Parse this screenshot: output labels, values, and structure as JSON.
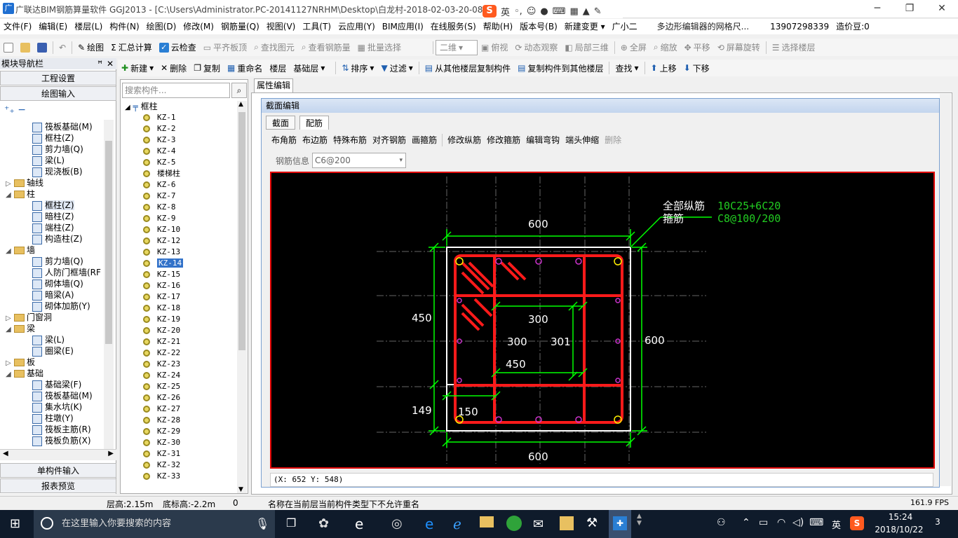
{
  "titlebar": {
    "title": "广联达BIM钢筋算量软件 GGJ2013 - [C:\\Users\\Administrator.PC-20141127NRHM\\Desktop\\白龙村-2018-02-03-20-08",
    "ime_label": "英",
    "minimize": "─",
    "restore": "❐",
    "close": "✕"
  },
  "menu": {
    "items": [
      "文件(F)",
      "编辑(E)",
      "楼层(L)",
      "构件(N)",
      "绘图(D)",
      "修改(M)",
      "钢筋量(Q)",
      "视图(V)",
      "工具(T)",
      "云应用(Y)",
      "BIM应用(I)",
      "在线服务(S)",
      "帮助(H)",
      "版本号(B)",
      "新建变更 ▾",
      "广小二",
      "多边形编辑器的网格尺..."
    ],
    "phone": "13907298339",
    "price_label": "造价豆:0"
  },
  "toolbar1": {
    "draw": "绘图",
    "sum": "汇总计算",
    "cloud_check": "云检查",
    "flat_top": "平齐板顶",
    "find_elem": "查找图元",
    "view_rebar": "查看钢筋量",
    "batch_select": "批量选择",
    "view_mode": "二维",
    "top_view": "俯视",
    "dynamic": "动态观察",
    "local3d": "局部三维",
    "fullscreen": "全屏",
    "zoom": "缩放",
    "pan": "平移",
    "rotate": "屏幕旋转",
    "select_floor": "选择楼层"
  },
  "toolbar2": {
    "new": "新建",
    "delete": "删除",
    "copy": "复制",
    "rename": "重命名",
    "floor": "楼层",
    "floor_value": "基础层",
    "sort": "排序",
    "filter": "过滤",
    "copy_from": "从其他楼层复制构件",
    "copy_to": "复制构件到其他楼层",
    "find": "查找",
    "move_up": "上移",
    "move_down": "下移"
  },
  "leftnav": {
    "header": "模块导航栏",
    "pin": "✕",
    "project_settings": "工程设置",
    "draw_input": "绘图输入",
    "single_input": "单构件输入",
    "report_preview": "报表预览",
    "tree": [
      {
        "label": "筏板基础(M)",
        "level": 2,
        "type": "item"
      },
      {
        "label": "框柱(Z)",
        "level": 2,
        "type": "item"
      },
      {
        "label": "剪力墙(Q)",
        "level": 2,
        "type": "item"
      },
      {
        "label": "梁(L)",
        "level": 2,
        "type": "item"
      },
      {
        "label": "现浇板(B)",
        "level": 2,
        "type": "item"
      },
      {
        "label": "轴线",
        "level": 1,
        "type": "folder",
        "exp": "▷"
      },
      {
        "label": "柱",
        "level": 1,
        "type": "folder",
        "exp": "◢"
      },
      {
        "label": "框柱(Z)",
        "level": 2,
        "type": "item",
        "selected": true
      },
      {
        "label": "暗柱(Z)",
        "level": 2,
        "type": "item"
      },
      {
        "label": "端柱(Z)",
        "level": 2,
        "type": "item"
      },
      {
        "label": "构造柱(Z)",
        "level": 2,
        "type": "item"
      },
      {
        "label": "墙",
        "level": 1,
        "type": "folder",
        "exp": "◢"
      },
      {
        "label": "剪力墙(Q)",
        "level": 2,
        "type": "item"
      },
      {
        "label": "人防门框墙(RF",
        "level": 2,
        "type": "item"
      },
      {
        "label": "砌体墙(Q)",
        "level": 2,
        "type": "item"
      },
      {
        "label": "暗梁(A)",
        "level": 2,
        "type": "item"
      },
      {
        "label": "砌体加筋(Y)",
        "level": 2,
        "type": "item"
      },
      {
        "label": "门窗洞",
        "level": 1,
        "type": "folder",
        "exp": "▷"
      },
      {
        "label": "梁",
        "level": 1,
        "type": "folder",
        "exp": "◢"
      },
      {
        "label": "梁(L)",
        "level": 2,
        "type": "item"
      },
      {
        "label": "圈梁(E)",
        "level": 2,
        "type": "item"
      },
      {
        "label": "板",
        "level": 1,
        "type": "folder",
        "exp": "▷"
      },
      {
        "label": "基础",
        "level": 1,
        "type": "folder",
        "exp": "◢"
      },
      {
        "label": "基础梁(F)",
        "level": 2,
        "type": "item"
      },
      {
        "label": "筏板基础(M)",
        "level": 2,
        "type": "item"
      },
      {
        "label": "集水坑(K)",
        "level": 2,
        "type": "item"
      },
      {
        "label": "柱墩(Y)",
        "level": 2,
        "type": "item"
      },
      {
        "label": "筏板主筋(R)",
        "level": 2,
        "type": "item"
      },
      {
        "label": "筏板负筋(X)",
        "level": 2,
        "type": "item"
      }
    ]
  },
  "complist": {
    "search_placeholder": "搜索构件...",
    "root": "框柱",
    "items": [
      "KZ-1",
      "KZ-2",
      "KZ-3",
      "KZ-4",
      "KZ-5",
      "楼梯柱",
      "KZ-6",
      "KZ-7",
      "KZ-8",
      "KZ-9",
      "KZ-10",
      "KZ-12",
      "KZ-13",
      "KZ-14",
      "KZ-15",
      "KZ-16",
      "KZ-17",
      "KZ-18",
      "KZ-19",
      "KZ-20",
      "KZ-21",
      "KZ-22",
      "KZ-23",
      "KZ-24",
      "KZ-25",
      "KZ-26",
      "KZ-27",
      "KZ-28",
      "KZ-29",
      "KZ-30",
      "KZ-31",
      "KZ-32",
      "KZ-33"
    ],
    "selected": "KZ-14"
  },
  "prop": {
    "tab": "属性编辑",
    "dialog_title": "截面编辑",
    "tab_section": "截面",
    "tab_rebar": "配筋",
    "rebar_buttons": [
      "布角筋",
      "布边筋",
      "特殊布筋",
      "对齐钢筋",
      "画箍筋",
      "修改纵筋",
      "修改箍筋",
      "编辑弯钩",
      "端头伸缩"
    ],
    "delete_disabled": "删除",
    "rebar_info_label": "钢筋信息",
    "rebar_info_value": "C6@200",
    "coord": "(X: 652 Y: 548)"
  },
  "drawing": {
    "dim_top": "600",
    "dim_bottom": "600",
    "dim_left": "450",
    "dim_right": "600",
    "dim_149": "149",
    "dim_150": "150",
    "inner_300_top": "300",
    "inner_300_left": "300",
    "inner_301": "301",
    "inner_450": "450",
    "label_all": "全部纵筋",
    "label_stirrup": "箍筋",
    "val_all": "10C25+6C20",
    "val_stirrup": "C8@100/200"
  },
  "status": {
    "floor_height": "层高:2.15m",
    "bottom_height": "底标高:-2.2m",
    "zero": "0",
    "message": "名称在当前层当前构件类型下不允许重名",
    "fps": "161.9 FPS"
  },
  "taskbar": {
    "search": "在这里输入你要搜索的内容",
    "ime": "英",
    "time": "15:24",
    "date": "2018/10/22",
    "notif": "3"
  },
  "colors": {
    "rebar": "#ff1a1a",
    "dimension": "#00ff00",
    "annotation_value": "#22cc22",
    "section": "#ffffff"
  }
}
